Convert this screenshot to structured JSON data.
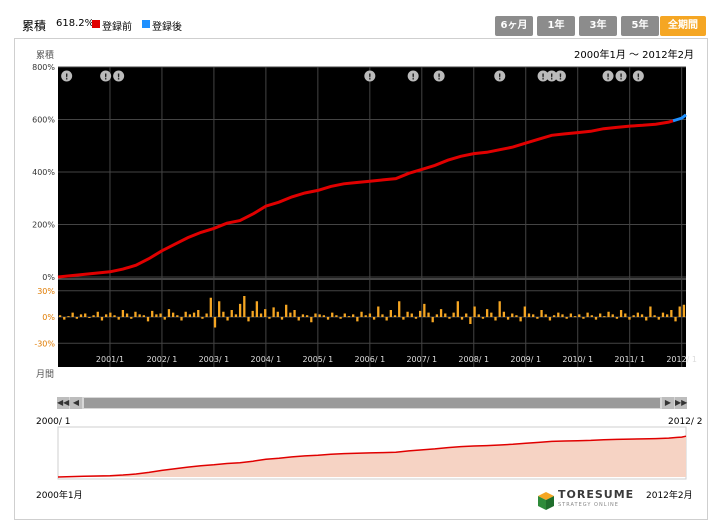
{
  "legend": {
    "title": "累積",
    "value": "618.2%",
    "series": [
      {
        "label": "登録前",
        "color": "#e00000"
      },
      {
        "label": "登録後",
        "color": "#1e90ff"
      }
    ]
  },
  "tabs": [
    {
      "label": "6ヶ月",
      "active": false
    },
    {
      "label": "1年",
      "active": false
    },
    {
      "label": "3年",
      "active": false
    },
    {
      "label": "5年",
      "active": false
    },
    {
      "label": "全期間",
      "active": true
    }
  ],
  "date_range": "2000年1月 〜 2012年2月",
  "axis_labels": {
    "top": "累積",
    "bottom": "月間"
  },
  "overview": {
    "start_label": "2000/ 1",
    "end_label": "2012/ 2",
    "start_label_bottom": "2000年1月",
    "end_label_bottom": "2012年2月"
  },
  "logo": {
    "name": "TORESUME",
    "tagline": "STRATEGY ONLINE"
  },
  "chart_data": {
    "type": "line",
    "title": "",
    "x_start": "2000-01",
    "x_end": "2012-02",
    "cumulative": {
      "yticks": [
        "800%",
        "600%",
        "400%",
        "200%",
        "0%"
      ],
      "ylim": [
        0,
        800
      ],
      "series": [
        {
          "name": "登録前",
          "color": "#e00000",
          "points": [
            [
              "2000-01",
              0
            ],
            [
              "2000-07",
              10
            ],
            [
              "2001-01",
              20
            ],
            [
              "2001-04",
              30
            ],
            [
              "2001-07",
              45
            ],
            [
              "2001-10",
              70
            ],
            [
              "2002-01",
              100
            ],
            [
              "2002-04",
              125
            ],
            [
              "2002-07",
              150
            ],
            [
              "2002-10",
              170
            ],
            [
              "2003-01",
              185
            ],
            [
              "2003-04",
              205
            ],
            [
              "2003-07",
              215
            ],
            [
              "2003-10",
              240
            ],
            [
              "2004-01",
              270
            ],
            [
              "2004-04",
              285
            ],
            [
              "2004-07",
              305
            ],
            [
              "2004-10",
              320
            ],
            [
              "2005-01",
              330
            ],
            [
              "2005-04",
              345
            ],
            [
              "2005-07",
              355
            ],
            [
              "2005-10",
              360
            ],
            [
              "2006-01",
              365
            ],
            [
              "2006-04",
              370
            ],
            [
              "2006-07",
              375
            ],
            [
              "2006-10",
              395
            ],
            [
              "2007-01",
              410
            ],
            [
              "2007-04",
              425
            ],
            [
              "2007-07",
              445
            ],
            [
              "2007-10",
              460
            ],
            [
              "2008-01",
              470
            ],
            [
              "2008-04",
              475
            ],
            [
              "2008-07",
              485
            ],
            [
              "2008-10",
              495
            ],
            [
              "2009-01",
              510
            ],
            [
              "2009-04",
              525
            ],
            [
              "2009-07",
              540
            ],
            [
              "2009-10",
              545
            ],
            [
              "2010-01",
              550
            ],
            [
              "2010-04",
              555
            ],
            [
              "2010-07",
              565
            ],
            [
              "2010-10",
              570
            ],
            [
              "2011-01",
              575
            ],
            [
              "2011-04",
              578
            ],
            [
              "2011-07",
              582
            ],
            [
              "2011-10",
              590
            ],
            [
              "2011-11",
              595
            ]
          ]
        },
        {
          "name": "登録後",
          "color": "#1e90ff",
          "points": [
            [
              "2011-11",
              595
            ],
            [
              "2011-12",
              600
            ],
            [
              "2012-01",
              605
            ],
            [
              "2012-02",
              618
            ]
          ]
        }
      ]
    },
    "monthly": {
      "yticks": [
        "30%",
        "0%",
        "-30%"
      ],
      "ylim": [
        -40,
        40
      ],
      "color": "#f5a623",
      "values": [
        2,
        -3,
        1,
        5,
        -2,
        3,
        4,
        -1,
        2,
        6,
        -4,
        3,
        5,
        2,
        -3,
        8,
        4,
        -2,
        6,
        3,
        2,
        -5,
        7,
        3,
        4,
        -3,
        9,
        5,
        2,
        -4,
        6,
        3,
        5,
        8,
        -2,
        4,
        22,
        -12,
        18,
        6,
        -4,
        8,
        3,
        15,
        24,
        -5,
        7,
        18,
        4,
        9,
        -2,
        11,
        6,
        -3,
        14,
        5,
        8,
        -4,
        3,
        2,
        -6,
        4,
        3,
        2,
        -3,
        5,
        2,
        -2,
        4,
        1,
        3,
        -5,
        6,
        2,
        4,
        -3,
        12,
        3,
        -4,
        8,
        2,
        18,
        -3,
        6,
        4,
        -2,
        7,
        15,
        5,
        -6,
        3,
        9,
        4,
        -2,
        5,
        18,
        -3,
        4,
        -8,
        12,
        3,
        -2,
        9,
        5,
        -4,
        18,
        6,
        -3,
        4,
        2,
        -5,
        12,
        4,
        3,
        -2,
        8,
        3,
        -4,
        2,
        5,
        3,
        -2,
        4,
        1,
        3,
        -2,
        5,
        2,
        -3,
        4,
        1,
        6,
        3,
        -2,
        8,
        4,
        -3,
        2,
        5,
        3,
        -4,
        12,
        2,
        -3,
        5,
        3,
        8,
        -5,
        12,
        14
      ]
    },
    "x_tick_labels": [
      "2001/1",
      "2002/ 1",
      "2003/ 1",
      "2004/ 1",
      "2005/ 1",
      "2006/ 1",
      "2007/ 1",
      "2008/ 1",
      "2009/ 1",
      "2010/ 1",
      "2011/ 1",
      "2012/ 1"
    ],
    "event_markers": [
      "2000-03",
      "2000-12",
      "2001-03",
      "2006-01",
      "2006-11",
      "2007-05",
      "2008-07",
      "2009-05",
      "2009-07",
      "2009-09",
      "2010-08",
      "2010-11",
      "2011-03"
    ]
  }
}
